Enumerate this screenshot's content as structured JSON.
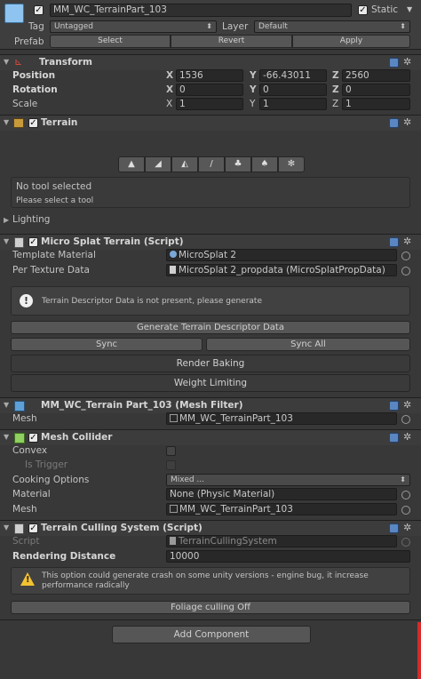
{
  "object_header": {
    "name": "MM_WC_TerrainPart_103",
    "static_label": "Static",
    "tag_label": "Tag",
    "tag_value": "Untagged",
    "layer_label": "Layer",
    "layer_value": "Default",
    "prefab_label": "Prefab",
    "prefab_buttons": [
      "Select",
      "Revert",
      "Apply"
    ]
  },
  "transform": {
    "title": "Transform",
    "rows": [
      {
        "label": "Position",
        "x": "1536",
        "y": "-66.43011",
        "z": "2560"
      },
      {
        "label": "Rotation",
        "x": "0",
        "y": "0",
        "z": "0"
      },
      {
        "label": "Scale",
        "x": "1",
        "y": "1",
        "z": "1"
      }
    ],
    "axis_labels": [
      "X",
      "Y",
      "Z"
    ]
  },
  "terrain": {
    "title": "Terrain",
    "tools": [
      "▲",
      "◢",
      "◭",
      "/",
      "♣",
      "♠",
      "✻"
    ],
    "info_title": "No tool selected",
    "info_sub": "Please select a tool",
    "lighting_label": "Lighting"
  },
  "microsplat": {
    "title": "Micro Splat Terrain (Script)",
    "template_label": "Template Material",
    "template_value": "MicroSplat 2",
    "per_texture_label": "Per Texture Data",
    "per_texture_value": "MicroSplat 2_propdata (MicroSplatPropData)",
    "help_text": "Terrain Descriptor Data is not present, please generate",
    "generate_button": "Generate Terrain Descriptor Data",
    "sync_button": "Sync",
    "sync_all_button": "Sync All",
    "render_baking_button": "Render Baking",
    "weight_limiting_button": "Weight Limiting"
  },
  "mesh_filter": {
    "title": "MM_WC_Terrain Part_103 (Mesh Filter)",
    "mesh_label": "Mesh",
    "mesh_value": "MM_WC_TerrainPart_103"
  },
  "mesh_collider": {
    "title": "Mesh Collider",
    "convex_label": "Convex",
    "trigger_label": "Is Trigger",
    "cooking_label": "Cooking Options",
    "cooking_value": "Mixed ...",
    "material_label": "Material",
    "material_value": "None (Physic Material)",
    "mesh_label": "Mesh",
    "mesh_value": "MM_WC_TerrainPart_103"
  },
  "culling": {
    "title": "Terrain Culling System (Script)",
    "script_label": "Script",
    "script_value": "TerrainCullingSystem",
    "distance_label": "Rendering Distance",
    "distance_value": "10000",
    "warning_text": "This option could generate crash on some unity versions - engine bug, it increase performance radically",
    "foliage_button": "Foliage culling Off"
  },
  "add_component_button": "Add Component",
  "colors": {
    "background": "#383838",
    "header": "#3c3c3c",
    "field": "#282828",
    "button": "#565656",
    "accent_blue": "#5a86c2",
    "cube_blue": "#8fc3f0",
    "warning_yellow": "#f2c230",
    "scroll_red": "#d62b2b"
  }
}
